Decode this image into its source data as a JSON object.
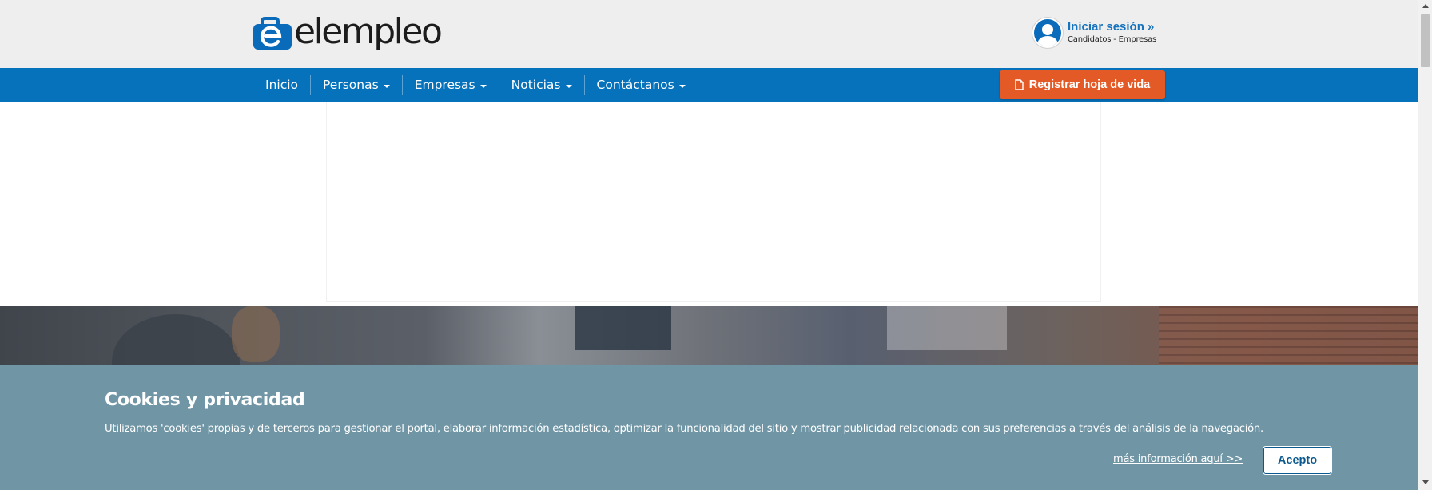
{
  "header": {
    "logo_text": "elempleo",
    "login": {
      "title": "Iniciar sesión",
      "chevron": "»",
      "subtitle": "Candidatos - Empresas",
      "icon": "user-avatar-icon"
    }
  },
  "nav": {
    "items": [
      {
        "label": "Inicio",
        "dropdown": false
      },
      {
        "label": "Personas",
        "dropdown": true
      },
      {
        "label": "Empresas",
        "dropdown": true
      },
      {
        "label": "Noticias",
        "dropdown": true
      },
      {
        "label": "Contáctanos",
        "dropdown": true
      }
    ],
    "register_button": "Registrar hoja de vida",
    "register_icon": "document-icon"
  },
  "cookies": {
    "title": "Cookies y privacidad",
    "text": "Utilizamos 'cookies' propias y de terceros para gestionar el portal, elaborar información estadística, optimizar la funcionalidad del sitio y mostrar publicidad relacionada con sus preferencias a través del análisis de la navegación.",
    "more_link": "más información aquí >>",
    "accept_button": "Acepto"
  },
  "colors": {
    "nav_blue": "#0672bc",
    "register_orange": "#e35a26",
    "cookie_bg": "#7096a6",
    "header_bg": "#eeeeee"
  }
}
